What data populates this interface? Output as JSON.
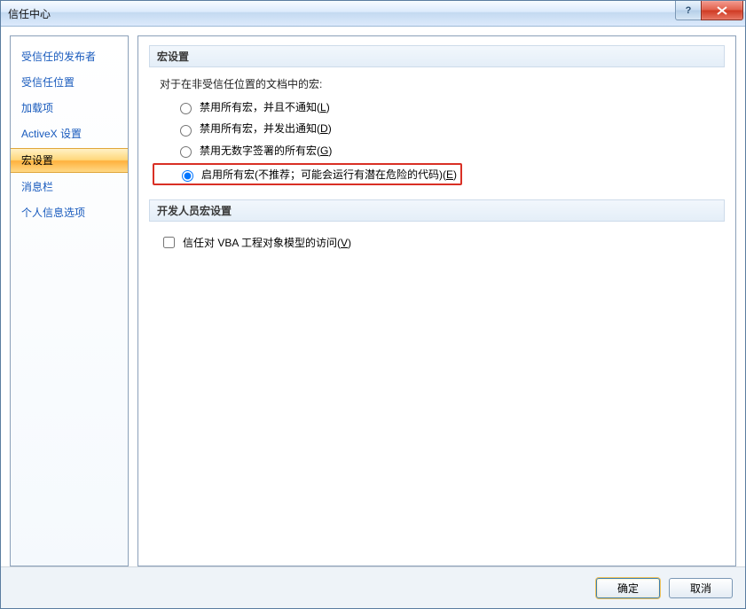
{
  "window": {
    "title": "信任中心"
  },
  "sidebar": {
    "items": [
      {
        "label": "受信任的发布者"
      },
      {
        "label": "受信任位置"
      },
      {
        "label": "加载项"
      },
      {
        "label": "ActiveX 设置"
      },
      {
        "label": "宏设置",
        "selected": true
      },
      {
        "label": "消息栏"
      },
      {
        "label": "个人信息选项"
      }
    ]
  },
  "main": {
    "section1_title": "宏设置",
    "intro": "对于在非受信任位置的文档中的宏:",
    "radio_options": [
      {
        "text": "禁用所有宏，并且不通知",
        "accel": "L"
      },
      {
        "text": "禁用所有宏，并发出通知",
        "accel": "D"
      },
      {
        "text": "禁用无数字签署的所有宏",
        "accel": "G"
      },
      {
        "text": "启用所有宏(不推荐；可能会运行有潜在危险的代码)",
        "accel": "E",
        "selected": true,
        "highlighted": true
      }
    ],
    "section2_title": "开发人员宏设置",
    "checkbox": {
      "text": "信任对 VBA 工程对象模型的访问",
      "accel": "V"
    }
  },
  "footer": {
    "ok": "确定",
    "cancel": "取消"
  }
}
